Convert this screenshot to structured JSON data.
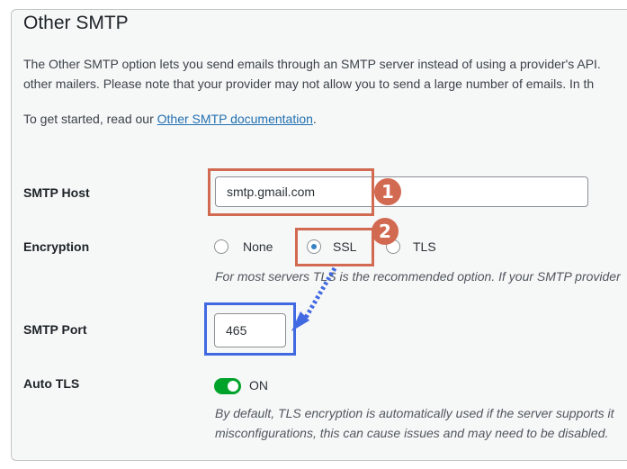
{
  "section": {
    "title": "Other SMTP",
    "description_lines": [
      "The Other SMTP option lets you send emails through an SMTP server instead of using a provider's API.",
      "other mailers. Please note that your provider may not allow you to send a large number of emails. In th"
    ],
    "get_started_prefix": "To get started, read our ",
    "doc_link": "Other SMTP documentation",
    "get_started_suffix": "."
  },
  "smtp_host": {
    "label": "SMTP Host",
    "value": "smtp.gmail.com"
  },
  "encryption": {
    "label": "Encryption",
    "options": [
      "None",
      "SSL",
      "TLS"
    ],
    "selected": "SSL",
    "help": "For most servers TLS is the recommended option. If your SMTP provider"
  },
  "smtp_port": {
    "label": "SMTP Port",
    "value": "465"
  },
  "auto_tls": {
    "label": "Auto TLS",
    "state": "ON",
    "help_lines": [
      "By default, TLS encryption is automatically used if the server supports it",
      "misconfigurations, this can cause issues and may need to be disabled."
    ]
  },
  "annotations": {
    "badges": [
      "1",
      "2"
    ],
    "highlight_color": "#d26a52",
    "port_highlight_color": "#4169e1"
  }
}
